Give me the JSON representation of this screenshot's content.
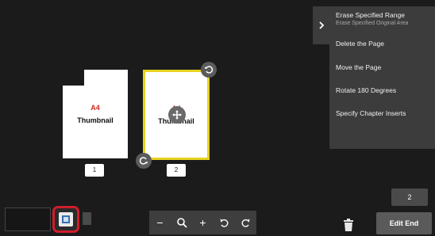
{
  "pages": [
    {
      "size_label": "A4",
      "thumb_label": "Thumbnail",
      "number": "1"
    },
    {
      "size_label": "A4",
      "thumb_label": "Thumbnail",
      "number": "2"
    }
  ],
  "menu": {
    "items": [
      {
        "label": "Erase Specified Range",
        "sub": "Erase Specified Original Area"
      },
      {
        "label": "Delete the Page"
      },
      {
        "label": "Move the Page"
      },
      {
        "label": "Rotate 180 Degrees"
      },
      {
        "label": "Specify Chapter Inserts"
      }
    ]
  },
  "zoom_bar": {
    "minus": "−",
    "plus": "+"
  },
  "page_count": "2",
  "edit_end_label": "Edit End",
  "icons": {
    "menu_toggle": "chevron-right-icon",
    "rotate": "rotate-icon",
    "move": "move-icon",
    "zoom": "magnifier-icon",
    "undo": "undo-icon",
    "redo": "redo-icon",
    "trash": "trash-icon",
    "mode": "page-view-icon"
  },
  "colors": {
    "selected_border": "#e6d21f",
    "highlight_ring": "#d01d2a",
    "size_label": "#d4271f"
  }
}
